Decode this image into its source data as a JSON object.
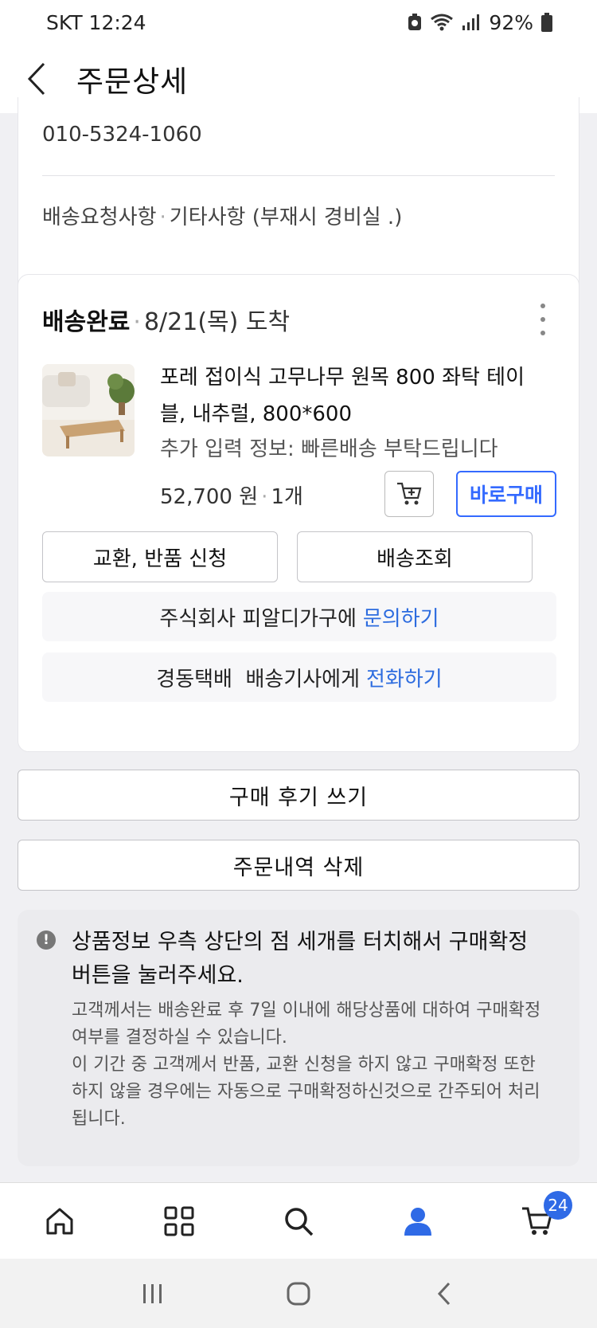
{
  "status_bar": {
    "carrier_time": "SKT 12:24",
    "battery": "92%"
  },
  "header": {
    "title": "주문상세"
  },
  "address": {
    "phone": "010-5324-1060",
    "request_label": "배송요청사항",
    "request_value": "기타사항 (부재시 경비실 .)"
  },
  "order": {
    "status": "배송완료",
    "arrival": "8/21(목) 도착",
    "product_name": "포레 접이식 고무나무 원목 800 좌탁 테이블, 내추럴, 800*600",
    "option": "추가 입력 정보: 빠른배송 부탁드립니다",
    "price": "52,700 원",
    "quantity": "1개",
    "buy_now": "바로구매",
    "exchange_return": "교환, 반품 신청",
    "track": "배송조회",
    "seller_text": "주식회사 피알디가구에",
    "seller_link": "문의하기",
    "courier_text": "경동택배  배송기사에게",
    "courier_link": "전화하기"
  },
  "actions": {
    "write_review": "구매 후기 쓰기",
    "delete_order": "주문내역 삭제"
  },
  "notice": {
    "headline": "상품정보 우측 상단의 점 세개를 터치해서 구매확정 버튼을 눌러주세요.",
    "body1": "고객께서는 배송완료 후 7일 이내에 해당상품에 대하여 구매확정 여부를 결정하실 수 있습니다.",
    "body2": "이 기간 중 고객께서 반품, 교환 신청을 하지 않고 구매확정 또한 하지 않을 경우에는 자동으로 구매확정하신것으로 간주되어 처리됩니다."
  },
  "bottom_nav": {
    "cart_badge": "24",
    "active": "my-page",
    "accent": "#2f6ae6"
  }
}
